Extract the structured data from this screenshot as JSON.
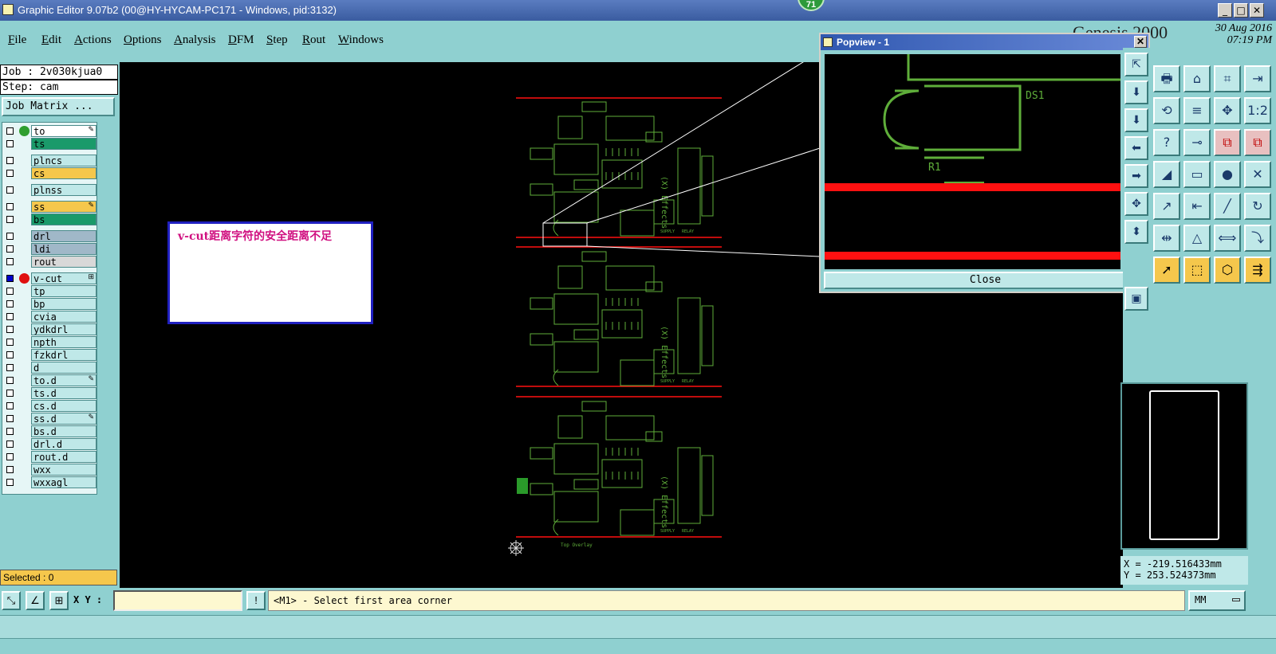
{
  "window": {
    "title": "Graphic Editor 9.07b2 (00@HY-HYCAM-PC171 - Windows, pid:3132)",
    "badge": "71",
    "min": "_",
    "max": "□",
    "close": "✕"
  },
  "menu": [
    "File",
    "Edit",
    "Actions",
    "Options",
    "Analysis",
    "DFM",
    "Step",
    "Rout",
    "Windows"
  ],
  "brand": {
    "name": "Genesis 2000",
    "date": "30 Aug 2016",
    "time": "07:19 PM"
  },
  "job": {
    "job_label": "Job : 2v030kjua0",
    "step_label": "Step: cam",
    "matrix_button": "Job Matrix ..."
  },
  "layers": [
    {
      "name": "to",
      "color": "#ffffff",
      "dot": "#2f9e2f",
      "mark": "✎",
      "checked": false
    },
    {
      "name": "ts",
      "color": "#1a9a6a",
      "dot": "",
      "mark": "",
      "checked": false
    },
    {
      "name": "plncs",
      "color": "#bfe8e8",
      "dot": "",
      "mark": "",
      "checked": false
    },
    {
      "name": "cs",
      "color": "#f5c74c",
      "dot": "",
      "mark": "",
      "checked": false
    },
    {
      "name": "plnss",
      "color": "#bfe8e8",
      "dot": "",
      "mark": "",
      "checked": false
    },
    {
      "name": "ss",
      "color": "#f5c74c",
      "dot": "",
      "mark": "✎",
      "checked": false
    },
    {
      "name": "bs",
      "color": "#1a9a6a",
      "dot": "",
      "mark": "",
      "checked": false
    },
    {
      "name": "drl",
      "color": "#a0b8c8",
      "dot": "",
      "mark": "",
      "checked": false
    },
    {
      "name": "ldi",
      "color": "#a0b8c8",
      "dot": "",
      "mark": "",
      "checked": false
    },
    {
      "name": "rout",
      "color": "#d8d8d8",
      "dot": "",
      "mark": "",
      "checked": false
    },
    {
      "name": "v-cut",
      "color": "#bfe8e8",
      "dot": "#e01010",
      "mark": "⊞",
      "checked": true
    },
    {
      "name": "tp",
      "color": "#bfe8e8",
      "dot": "",
      "mark": "",
      "checked": false
    },
    {
      "name": "bp",
      "color": "#bfe8e8",
      "dot": "",
      "mark": "",
      "checked": false
    },
    {
      "name": "cvia",
      "color": "#bfe8e8",
      "dot": "",
      "mark": "",
      "checked": false
    },
    {
      "name": "ydkdrl",
      "color": "#bfe8e8",
      "dot": "",
      "mark": "",
      "checked": false
    },
    {
      "name": "npth",
      "color": "#bfe8e8",
      "dot": "",
      "mark": "",
      "checked": false
    },
    {
      "name": "fzkdrl",
      "color": "#bfe8e8",
      "dot": "",
      "mark": "",
      "checked": false
    },
    {
      "name": "d",
      "color": "#bfe8e8",
      "dot": "",
      "mark": "",
      "checked": false
    },
    {
      "name": "to.d",
      "color": "#bfe8e8",
      "dot": "",
      "mark": "✎",
      "checked": false
    },
    {
      "name": "ts.d",
      "color": "#bfe8e8",
      "dot": "",
      "mark": "",
      "checked": false
    },
    {
      "name": "cs.d",
      "color": "#bfe8e8",
      "dot": "",
      "mark": "",
      "checked": false
    },
    {
      "name": "ss.d",
      "color": "#bfe8e8",
      "dot": "",
      "mark": "✎",
      "checked": false
    },
    {
      "name": "bs.d",
      "color": "#bfe8e8",
      "dot": "",
      "mark": "",
      "checked": false
    },
    {
      "name": "drl.d",
      "color": "#bfe8e8",
      "dot": "",
      "mark": "",
      "checked": false
    },
    {
      "name": "rout.d",
      "color": "#bfe8e8",
      "dot": "",
      "mark": "",
      "checked": false
    },
    {
      "name": "wxx",
      "color": "#bfe8e8",
      "dot": "",
      "mark": "",
      "checked": false
    },
    {
      "name": "wxxagl",
      "color": "#bfe8e8",
      "dot": "",
      "mark": "",
      "checked": false
    }
  ],
  "selected_label": "Selected : 0",
  "annotation": {
    "text": "v-cut距离字符的安全距离不足"
  },
  "canvas": {
    "board_text": [
      "(X) Effects",
      "SUPPLY",
      "RELAY"
    ],
    "footer_text": "Top Overlay"
  },
  "popview": {
    "title": "Popview - 1",
    "close_x": "✕",
    "close_button": "Close",
    "labels": [
      "DS1",
      "R1"
    ]
  },
  "toolbar_icons": [
    "print",
    "home",
    "xy",
    "export",
    "undo-redo",
    "snap",
    "move",
    "scale",
    "help",
    "dimension",
    "layer-a",
    "layer-b",
    "measure",
    "ruler",
    "circle",
    "cross",
    "arc",
    "split",
    "line",
    "rotate",
    "mirror",
    "delta",
    "stretch",
    "step",
    "select",
    "select-rect",
    "select-hex",
    "select-multi"
  ],
  "coords": {
    "x": "X = -219.516433mm",
    "y": "Y = 253.524373mm"
  },
  "status": {
    "xy_label": "X Y :",
    "xy_value": "",
    "message": "<M1> - Select first area corner",
    "unit": "MM"
  },
  "colors": {
    "panel": "#8fd0d0",
    "canvas": "#000000",
    "vcut": "#ff1010",
    "silkscreen": "#5fae3a",
    "annotation": "#d01080"
  }
}
